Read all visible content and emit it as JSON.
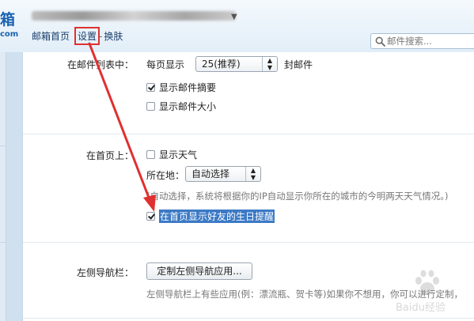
{
  "header": {
    "brand_char": "箱",
    "brand_sub": "com",
    "nav": {
      "home": "邮箱首页",
      "settings": "设置",
      "separator": "-",
      "skin": "换肤"
    },
    "search": {
      "placeholder": "邮件搜索..."
    }
  },
  "settings": {
    "list_section": {
      "label": "在邮件列表中：",
      "per_page_prefix": "每页显示",
      "per_page_value": "25(推荐)",
      "per_page_suffix": "封邮件",
      "show_summary": {
        "label": "显示邮件摘要",
        "checked": true
      },
      "show_size": {
        "label": "显示邮件大小",
        "checked": false
      }
    },
    "home_section": {
      "label": "在首页上：",
      "show_weather": {
        "label": "显示天气",
        "checked": false
      },
      "location_label": "所在地：",
      "location_value": "自动选择",
      "hint": "(自动选择，系统将根据你的IP自动显示你所在的城市的今明两天天气情况。)",
      "birthday": {
        "label": "在首页显示好友的生日提醒",
        "checked": true
      }
    },
    "nav_section": {
      "label": "左侧导航栏：",
      "button": "定制左侧导航应用...",
      "hint": "左侧导航栏上有些应用(例：漂流瓶、贺卡等)如果你不想用，你可以进行定制，"
    }
  },
  "watermark": {
    "text": "Baidu经验"
  },
  "icons": {
    "search": "search-icon",
    "dropdown": "chevron-up-down-icon",
    "account_caret": "caret-down-icon",
    "annotation": "red-arrow"
  },
  "colors": {
    "accent": "#1a62b0",
    "annotation": "#e03030",
    "highlight": "#3b79c5"
  }
}
